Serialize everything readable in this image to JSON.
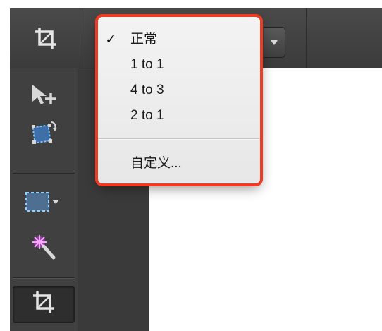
{
  "toolbar": {
    "crop_icon": "crop-icon",
    "aspect_dropdown_caret": "chevron-down-icon"
  },
  "aspect_menu": {
    "selected_check": "✓",
    "items": [
      {
        "label": "正常",
        "selected": true
      },
      {
        "label": "1 to 1",
        "selected": false
      },
      {
        "label": "4 to 3",
        "selected": false
      },
      {
        "label": "2 to 1",
        "selected": false
      }
    ],
    "custom_label": "自定义..."
  },
  "tools": [
    {
      "icon": "move-selection-icon"
    },
    {
      "icon": "rotate-transform-icon"
    },
    {
      "icon": "rectangle-marquee-icon"
    },
    {
      "icon": "magic-wand-icon"
    },
    {
      "icon": "crop-icon",
      "active": true
    }
  ],
  "colors": {
    "highlight_outline": "#ef3a24",
    "selection_blue": "#5aa9ff",
    "wand_magenta": "#e040fb"
  }
}
